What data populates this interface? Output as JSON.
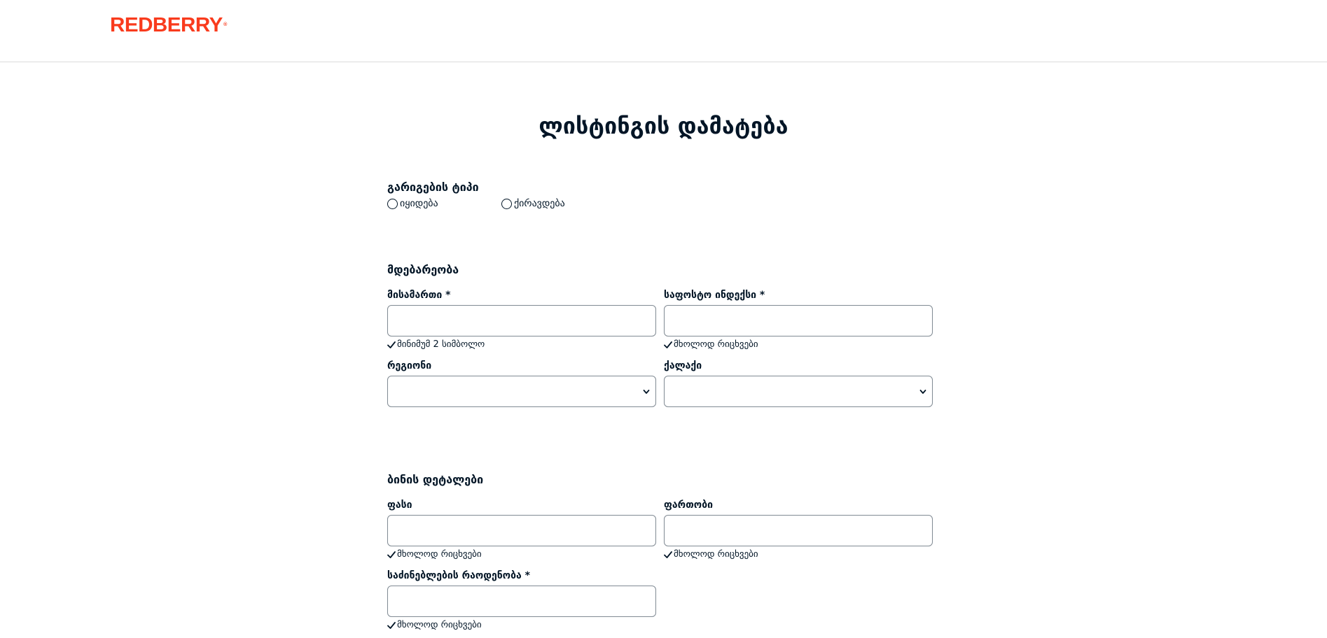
{
  "header": {
    "logo_text": "REDBERRY",
    "logo_mark": "®",
    "brand_color": "#F93B1D"
  },
  "page": {
    "title": "ლისტინგის დამატება"
  },
  "deal_type": {
    "title": "გარიგების ტიპი",
    "options": [
      {
        "label": "იყიდება",
        "selected": false
      },
      {
        "label": "ქირავდება",
        "selected": false
      }
    ]
  },
  "location": {
    "title": "მდებარეობა",
    "address": {
      "label": "მისამართი *",
      "value": "",
      "hint": "მინიმუმ 2 სიმბოლო"
    },
    "postal_code": {
      "label": "საფოსტო ინდექსი *",
      "value": "",
      "hint": "მხოლოდ რიცხვები"
    },
    "region": {
      "label": "რეგიონი",
      "selected": ""
    },
    "city": {
      "label": "ქალაქი",
      "selected": ""
    }
  },
  "apartment_details": {
    "title": "ბინის დეტალები",
    "price": {
      "label": "ფასი",
      "value": "",
      "hint": "მხოლოდ რიცხვები"
    },
    "area": {
      "label": "ფართობი",
      "value": "",
      "hint": "მხოლოდ რიცხვები"
    },
    "bedrooms": {
      "label": "საძინებლების რაოდენობა *",
      "value": "",
      "hint": "მხოლოდ რიცხვები"
    }
  },
  "icons": {
    "radio": "radio-unchecked-icon",
    "check": "check-icon",
    "dropdown": "chevron-down-icon"
  }
}
